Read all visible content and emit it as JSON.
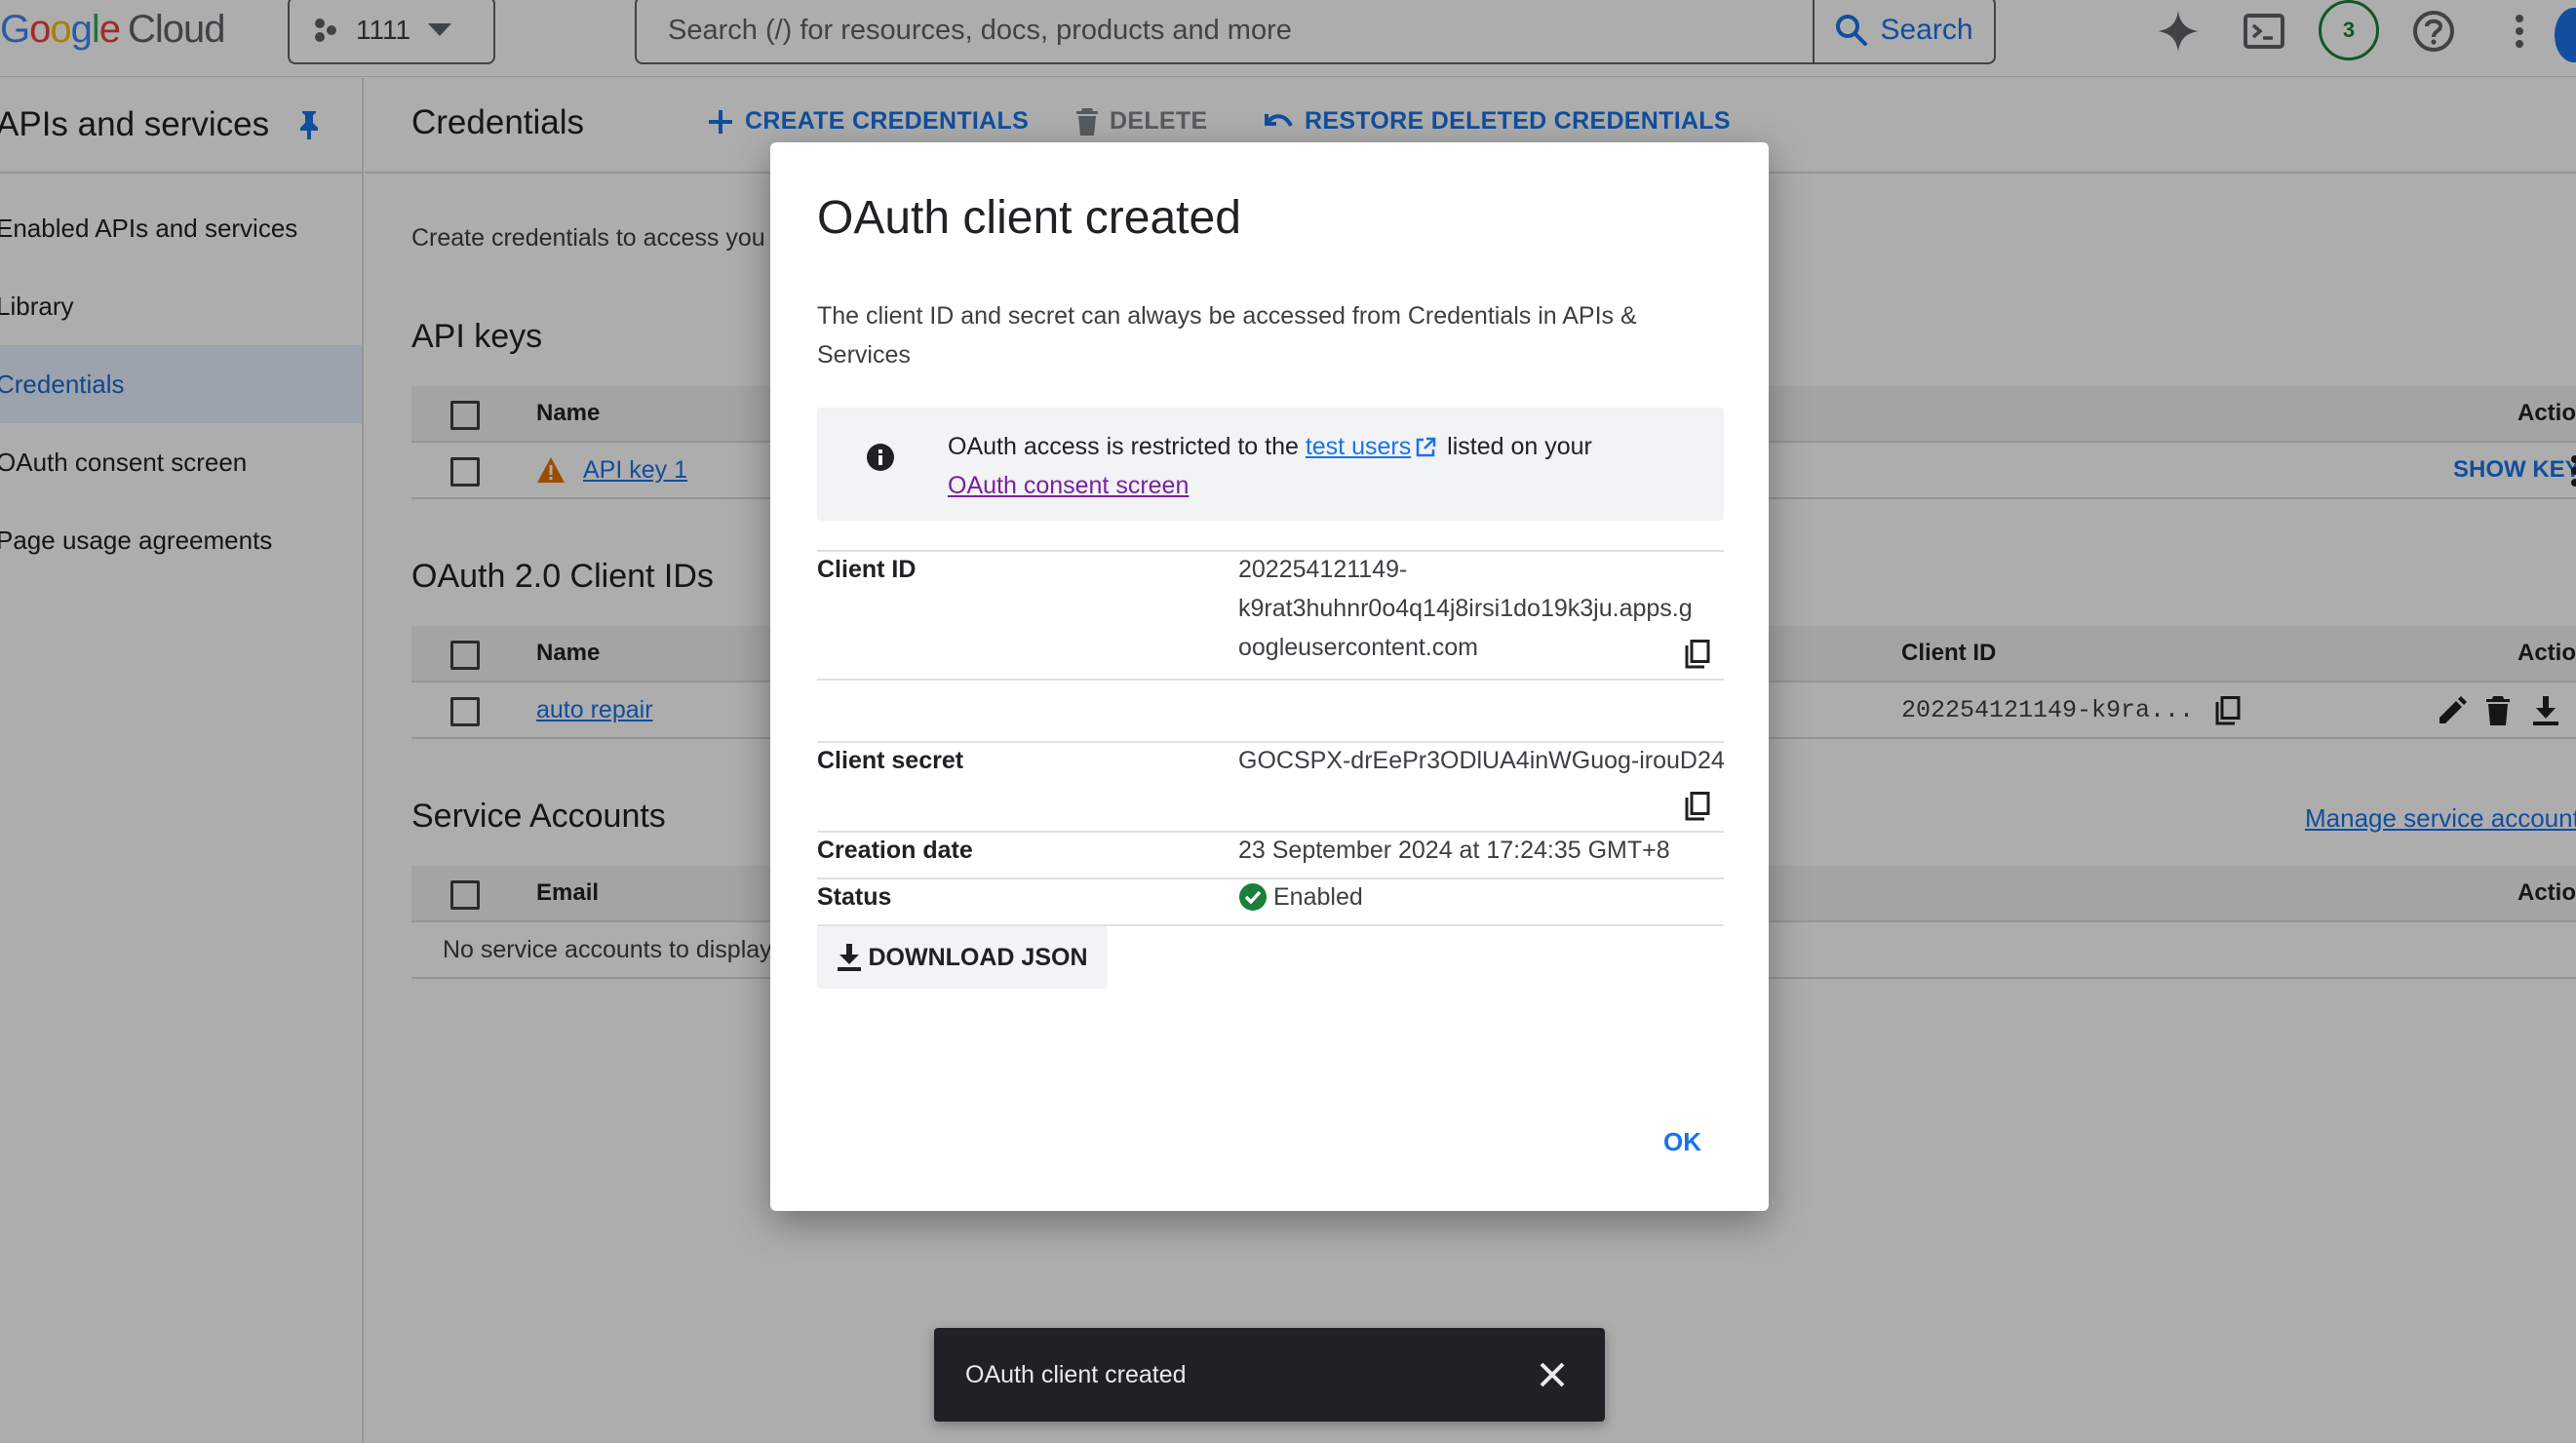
{
  "brand": {
    "google_letters": [
      "G",
      "o",
      "o",
      "g",
      "l",
      "e"
    ],
    "product": "Cloud"
  },
  "header": {
    "project": "1111",
    "search_placeholder": "Search (/) for resources, docs, products and more",
    "search_button": "Search",
    "notifications_count": "3"
  },
  "sidebar": {
    "title": "APIs and services",
    "items": [
      {
        "label": "Enabled APIs and services",
        "active": false
      },
      {
        "label": "Library",
        "active": false
      },
      {
        "label": "Credentials",
        "active": true
      },
      {
        "label": "OAuth consent screen",
        "active": false
      },
      {
        "label": "Page usage agreements",
        "active": false
      }
    ]
  },
  "main": {
    "title": "Credentials",
    "actions": {
      "create": "CREATE CREDENTIALS",
      "delete": "DELETE",
      "restore": "RESTORE DELETED CREDENTIALS"
    },
    "intro": "Create credentials to access you",
    "api_keys": {
      "title": "API keys",
      "columns": {
        "name": "Name",
        "actions": "Actions"
      },
      "rows": [
        {
          "name": "API key 1",
          "action": "SHOW KEY"
        }
      ]
    },
    "oauth": {
      "title": "OAuth 2.0 Client IDs",
      "columns": {
        "name": "Name",
        "client_id": "Client ID",
        "actions": "Actions"
      },
      "rows": [
        {
          "name": "auto repair",
          "client_id": "202254121149-k9ra..."
        }
      ]
    },
    "service_accounts": {
      "title": "Service Accounts",
      "manage_link": "Manage service accounts",
      "columns": {
        "email": "Email",
        "actions": "Actions"
      },
      "empty": "No service accounts to display"
    }
  },
  "dialog": {
    "title": "OAuth client created",
    "description": "The client ID and secret can always be accessed from Credentials in APIs & Services",
    "info": {
      "prefix": "OAuth access is restricted to the ",
      "link1": "test users",
      "middle": " listed on your ",
      "link2": "OAuth consent screen"
    },
    "client_id_label": "Client ID",
    "client_id_lines": [
      "202254121149-",
      "k9rat3huhnr0o4q14j8irsi1do19k3ju.apps.g",
      "oogleusercontent.com"
    ],
    "client_secret_label": "Client secret",
    "client_secret": "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",
    "creation_date_label": "Creation date",
    "creation_date": "23 September 2024 at 17:24:35 GMT+8",
    "status_label": "Status",
    "status": "Enabled",
    "download_button": "DOWNLOAD JSON",
    "ok_button": "OK"
  },
  "snackbar": {
    "message": "OAuth client created"
  },
  "colors": {
    "primary": "#1a73e8",
    "success": "#188038",
    "warning": "#e37400"
  }
}
